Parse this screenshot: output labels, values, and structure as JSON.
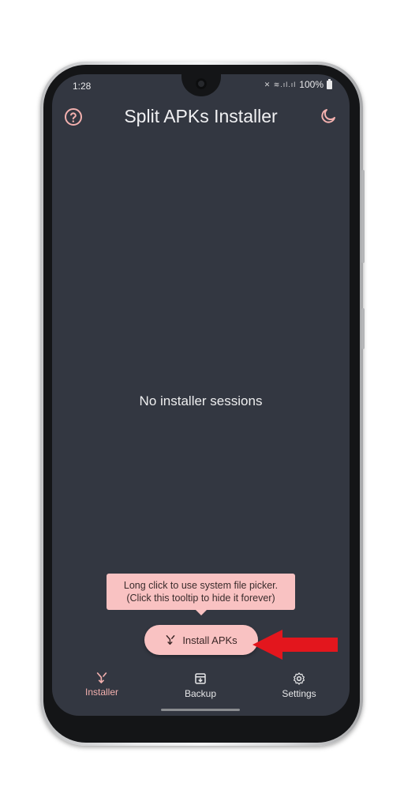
{
  "status_bar": {
    "time": "1:28",
    "signal_icons": "✕ ≋.ıl.ıl",
    "battery": "100%"
  },
  "app_bar": {
    "title": "Split APKs Installer",
    "help_icon": "help-circle-icon",
    "theme_icon": "moon-icon"
  },
  "main": {
    "empty_message": "No installer sessions"
  },
  "tooltip": {
    "line1": "Long click to use system file picker.",
    "line2": "(Click this tooltip to hide it forever)"
  },
  "fab": {
    "label": "Install APKs",
    "icon": "split-arrow-icon"
  },
  "bottom_nav": {
    "items": [
      {
        "label": "Installer",
        "icon": "split-arrow-icon",
        "active": true
      },
      {
        "label": "Backup",
        "icon": "backup-icon",
        "active": false
      },
      {
        "label": "Settings",
        "icon": "gear-icon",
        "active": false
      }
    ]
  },
  "colors": {
    "accent": "#f3b0ae",
    "screen_bg": "#333741",
    "fab_bg": "#f9c2c2",
    "arrow": "#e3161d"
  }
}
